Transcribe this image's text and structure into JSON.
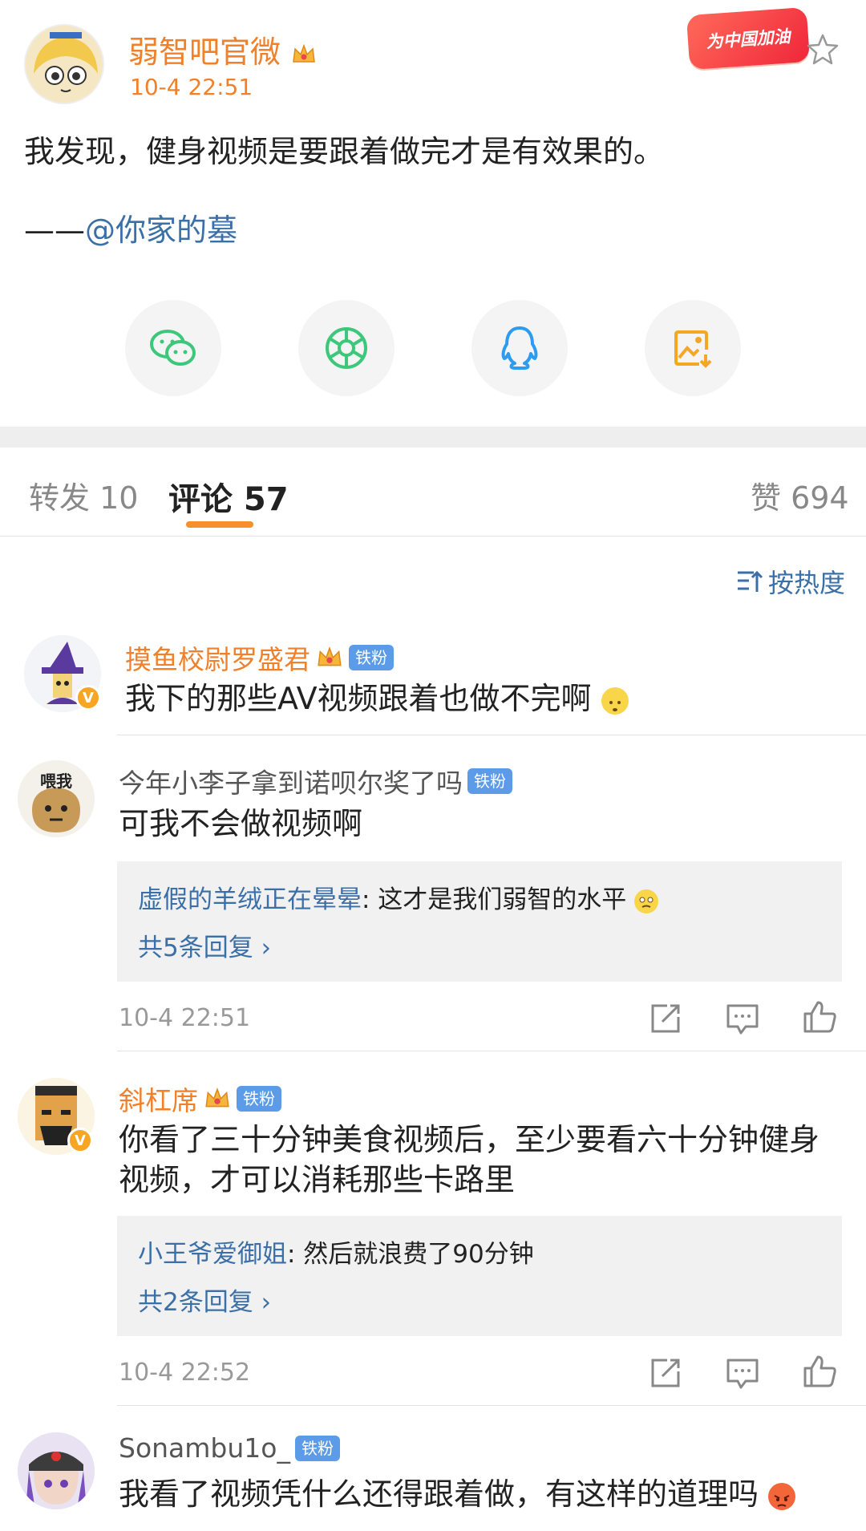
{
  "post": {
    "author": "弱智吧官微",
    "time": "10-4 22:51",
    "promo_badge": "为中国加油",
    "text": "我发现，健身视频是要跟着做完才是有效果的。",
    "credit_dash": "——",
    "credit_mention": "@你家的墓"
  },
  "share": {
    "icons": [
      "wechat-icon",
      "moments-icon",
      "qq-icon",
      "save-image-icon"
    ]
  },
  "tabs": {
    "repost": "转发 10",
    "comment": "评论 57",
    "like": "赞 694"
  },
  "sort": {
    "label": "按热度"
  },
  "comments": [
    {
      "name": "摸鱼校尉罗盛君",
      "fan": "铁粉",
      "text": "我下的那些AV视频跟着也做不完啊"
    },
    {
      "name": "今年小李子拿到诺呗尔奖了吗",
      "fan": "铁粉",
      "avatar_text": "喂我",
      "text": "可我不会做视频啊",
      "reply_user": "虚假的羊绒正在晕晕",
      "reply_text": ": 这才是我们弱智的水平",
      "reply_more": "共5条回复 ›",
      "time": "10-4 22:51"
    },
    {
      "name": "斜杠席",
      "fan": "铁粉",
      "text_line1": "你看了三十分钟美食视频后，至少要看六十分钟健身",
      "text_line2": "视频，才可以消耗那些卡路里",
      "reply_user": "小王爷爱御姐",
      "reply_text": ": 然后就浪费了90分钟",
      "reply_more": "共2条回复 ›",
      "time": "10-4 22:52"
    },
    {
      "name": "Sonambu1o_",
      "fan": "铁粉",
      "text": "我看了视频凭什么还得跟着做，有这样的道理吗"
    }
  ],
  "colors": {
    "accent_orange": "#f0812a",
    "link_blue": "#3b6fa8",
    "fan_badge": "#5b9be8",
    "tab_underline": "#f5902a"
  }
}
